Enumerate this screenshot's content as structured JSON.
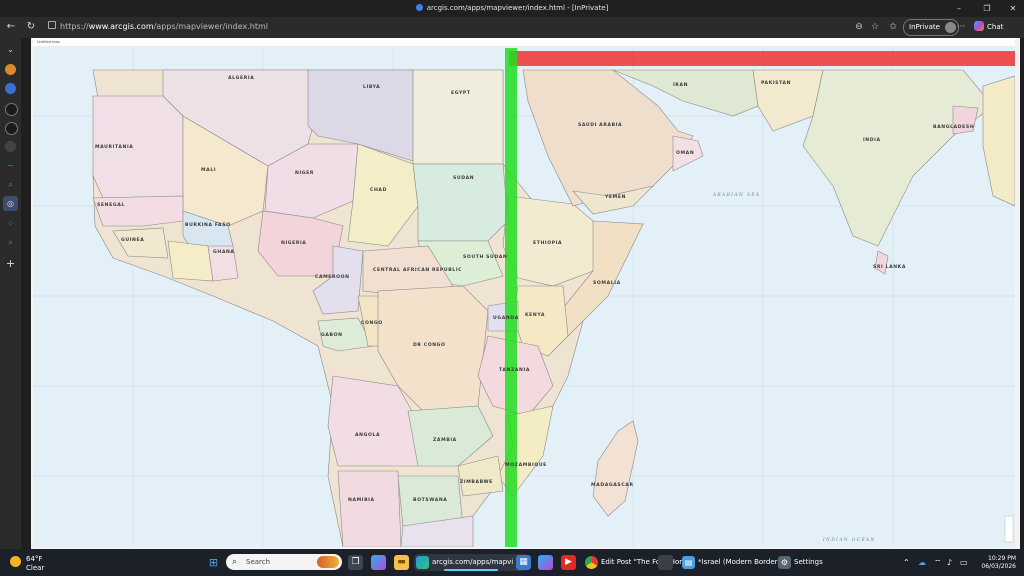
{
  "window": {
    "title": "arcgis.com/apps/mapviewer/index.html - [InPrivate]",
    "controls": [
      "–",
      "❐",
      "✕"
    ]
  },
  "browser": {
    "url_scheme": "https://",
    "url_host": "www.arcgis.com",
    "url_path": "/apps/mapviewer/index.html",
    "inprivate_label": "InPrivate",
    "chat_label": "Chat",
    "more_label": "···"
  },
  "map": {
    "header_text": "Untitled map",
    "overlays": {
      "green_band_color": "#22dd22",
      "red_band_color": "#ee2222"
    },
    "country_labels": {
      "algeria": "ALGERIA",
      "libya": "LIBYA",
      "egypt": "EGYPT",
      "mauritania": "MAURITANIA",
      "mali": "MALI",
      "niger": "NIGER",
      "chad": "CHAD",
      "sudan": "SUDAN",
      "south_sudan": "SOUTH SUDAN",
      "car": "CENTRAL AFRICAN REPUBLIC",
      "cameroon": "CAMEROON",
      "nigeria": "NIGERIA",
      "ghana": "GHANA",
      "guinea": "GUINEA",
      "senegal": "SENEGAL",
      "burkina": "BURKINA FASO",
      "ethiopia": "ETHIOPIA",
      "somalia": "SOMALIA",
      "kenya": "KENYA",
      "tanzania": "TANZANIA",
      "uganda": "UGANDA",
      "congo": "CONGO",
      "drc": "DR CONGO",
      "gabon": "GABON",
      "angola": "ANGOLA",
      "zambia": "ZAMBIA",
      "mozambique": "MOZAMBIQUE",
      "zimbabwe": "ZIMBABWE",
      "namibia": "NAMIBIA",
      "botswana": "BOTSWANA",
      "madagascar": "MADAGASCAR",
      "saudi": "SAUDI ARABIA",
      "yemen": "YEMEN",
      "oman": "OMAN",
      "iran": "IRAN",
      "pakistan": "PAKISTAN",
      "india": "INDIA",
      "sri_lanka": "SRI LANKA",
      "bangladesh": "BANGLADESH"
    },
    "sea_labels": {
      "indian_ocean": "INDIAN OCEAN",
      "arabian_sea": "ARABIAN SEA"
    }
  },
  "taskbar": {
    "weather_temp": "64°F",
    "weather_desc": "Clear",
    "search_placeholder": "Search",
    "tasks": {
      "edge": "arcgis.com/apps/mapvi",
      "chrome": "Edit Post \"The Four Hors",
      "notepad": "*Israel (Modern Borders",
      "settings": "Settings"
    },
    "time": "10:29 PM",
    "date": "06/03/2026"
  }
}
